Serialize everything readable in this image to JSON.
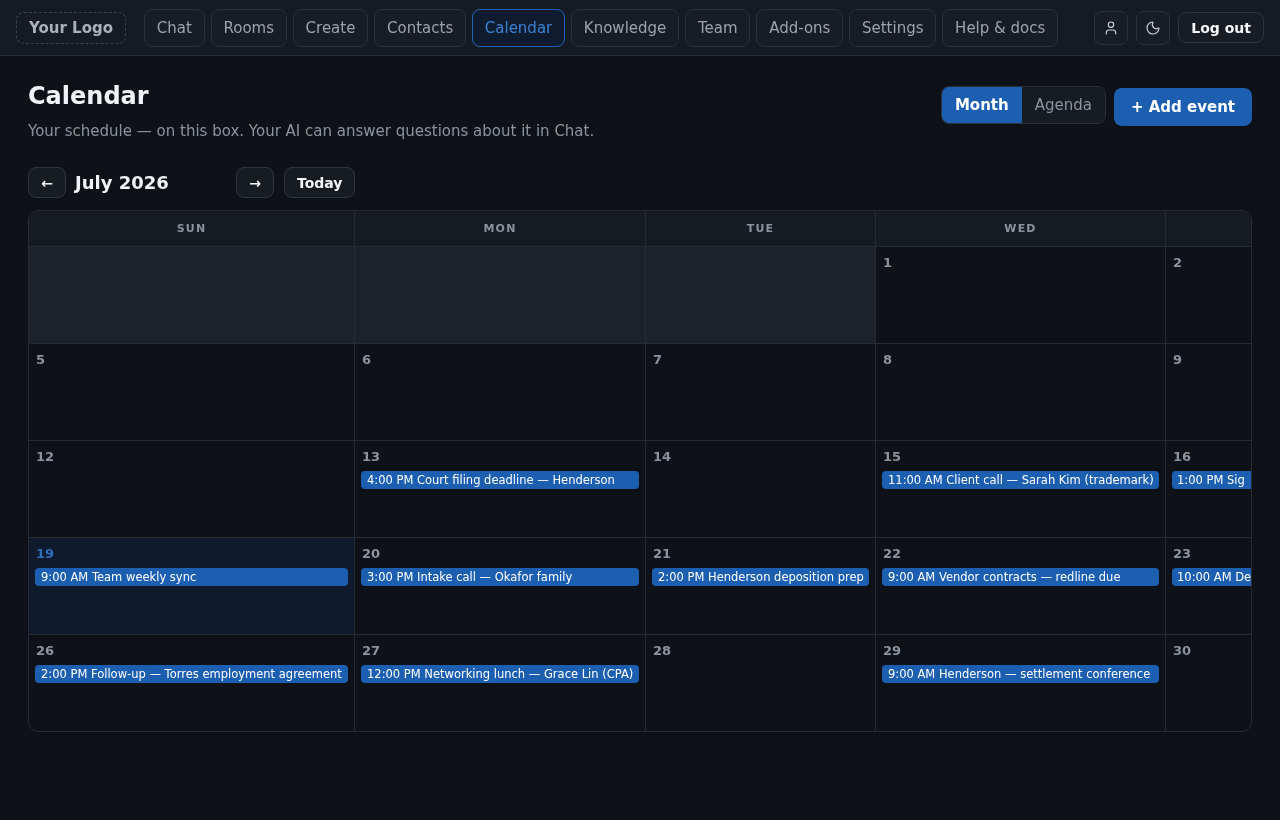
{
  "nav": {
    "logo": "Your Logo",
    "items": [
      {
        "label": "Chat",
        "selected": false
      },
      {
        "label": "Rooms",
        "selected": false
      },
      {
        "label": "Create",
        "selected": false
      },
      {
        "label": "Contacts",
        "selected": false
      },
      {
        "label": "Calendar",
        "selected": true
      },
      {
        "label": "Knowledge",
        "selected": false
      },
      {
        "label": "Team",
        "selected": false
      },
      {
        "label": "Add-ons",
        "selected": false
      },
      {
        "label": "Settings",
        "selected": false
      },
      {
        "label": "Help & docs",
        "selected": false
      }
    ],
    "logout": "Log out"
  },
  "header": {
    "title": "Calendar",
    "subtitle": "Your schedule — on this box. Your AI can answer questions about it in Chat.",
    "views": [
      {
        "label": "Month",
        "selected": true
      },
      {
        "label": "Agenda",
        "selected": false
      }
    ],
    "add_button": "+ Add event"
  },
  "month_nav": {
    "prev": "←",
    "label": "July 2026",
    "next": "→",
    "today": "Today"
  },
  "calendar": {
    "weekdays": [
      "SUN",
      "MON",
      "TUE",
      "WED"
    ],
    "weeks": [
      {
        "days": [
          {
            "kind": "outside"
          },
          {
            "kind": "outside"
          },
          {
            "kind": "outside"
          },
          {
            "kind": "day",
            "number": "1",
            "today": false
          },
          {
            "kind": "day",
            "number": "2",
            "today": false
          }
        ]
      },
      {
        "days": [
          {
            "kind": "day",
            "number": "5",
            "today": false
          },
          {
            "kind": "day",
            "number": "6",
            "today": false
          },
          {
            "kind": "day",
            "number": "7",
            "today": false
          },
          {
            "kind": "day",
            "number": "8",
            "today": false
          },
          {
            "kind": "day",
            "number": "9",
            "today": false
          }
        ]
      },
      {
        "days": [
          {
            "kind": "day",
            "number": "12",
            "today": false
          },
          {
            "kind": "day",
            "number": "13",
            "today": false,
            "events": [
              "4:00 PM Court filing deadline — Henderson"
            ]
          },
          {
            "kind": "day",
            "number": "14",
            "today": false
          },
          {
            "kind": "day",
            "number": "15",
            "today": false,
            "events": [
              "11:00 AM Client call — Sarah Kim (trademark)"
            ]
          },
          {
            "kind": "day",
            "number": "16",
            "today": false,
            "events": [
              "1:00 PM Sig"
            ]
          }
        ]
      },
      {
        "days": [
          {
            "kind": "day",
            "number": "19",
            "today": true,
            "events": [
              "9:00 AM Team weekly sync"
            ]
          },
          {
            "kind": "day",
            "number": "20",
            "today": false,
            "events": [
              "3:00 PM Intake call — Okafor family"
            ]
          },
          {
            "kind": "day",
            "number": "21",
            "today": false,
            "events": [
              "2:00 PM Henderson deposition prep"
            ]
          },
          {
            "kind": "day",
            "number": "22",
            "today": false,
            "events": [
              "9:00 AM Vendor contracts — redline due"
            ]
          },
          {
            "kind": "day",
            "number": "23",
            "today": false,
            "events": [
              "10:00 AM De"
            ]
          }
        ]
      },
      {
        "days": [
          {
            "kind": "day",
            "number": "26",
            "today": false,
            "events": [
              "2:00 PM Follow-up — Torres employment agreement"
            ]
          },
          {
            "kind": "day",
            "number": "27",
            "today": false,
            "events": [
              "12:00 PM Networking lunch — Grace Lin (CPA)"
            ]
          },
          {
            "kind": "day",
            "number": "28",
            "today": false
          },
          {
            "kind": "day",
            "number": "29",
            "today": false,
            "events": [
              "9:00 AM Henderson — settlement conference"
            ]
          },
          {
            "kind": "day",
            "number": "30",
            "today": false
          }
        ]
      }
    ]
  }
}
